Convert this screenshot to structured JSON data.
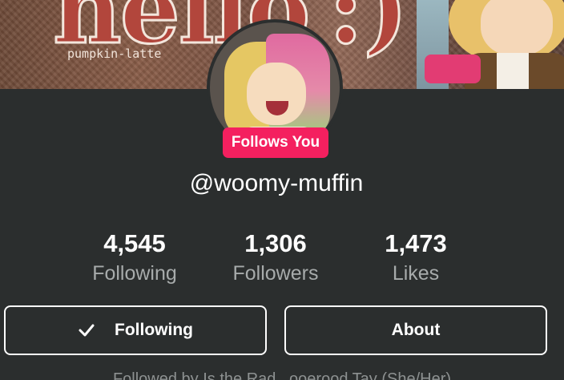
{
  "banner": {
    "word_left": "hello",
    "word_right": ":)",
    "caption": "pumpkin-latte"
  },
  "profile": {
    "follows_you_badge": "Follows You",
    "username": "@woomy-muffin"
  },
  "stats": [
    {
      "value": "4,545",
      "label": "Following"
    },
    {
      "value": "1,306",
      "label": "Followers"
    },
    {
      "value": "1,473",
      "label": "Likes"
    }
  ],
  "actions": {
    "following_label": "Following",
    "about_label": "About"
  },
  "bio_partial": "Followed by Is the Rad...ooerood Tay (She/Her)",
  "icons": {
    "following_check": "checkmark-icon"
  }
}
